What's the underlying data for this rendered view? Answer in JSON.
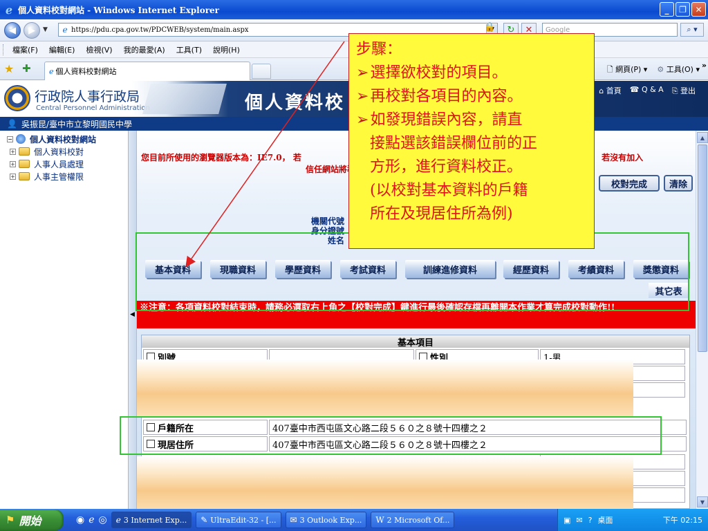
{
  "window": {
    "title": "個人資料校對網站 - Windows Internet Explorer",
    "buttons": {
      "minimize": "_",
      "restore": "❐",
      "close": "✕"
    }
  },
  "addressbar": {
    "url": "https://pdu.cpa.gov.tw/PDCWEB/system/main.aspx",
    "search_placeholder": "Google"
  },
  "menu": [
    "檔案(F)",
    "編輯(E)",
    "檢視(V)",
    "我的最愛(A)",
    "工具(T)",
    "說明(H)"
  ],
  "tabbar": {
    "tab_title": "個人資料校對網站",
    "tools": {
      "home": "網頁(P)",
      "tools": "工具(O)"
    }
  },
  "site": {
    "org_name": "行政院人事行政局",
    "org_name_en": "Central Personnel Administration",
    "banner_title": "個人資料校",
    "links": [
      "首頁",
      "Q & A",
      "登出"
    ],
    "user": "吳振昆/臺中市立黎明國民中學"
  },
  "sidebar": {
    "root": "個人資料校對網站",
    "items": [
      "個人資料校對",
      "人事人員處理",
      "人事主管權限"
    ]
  },
  "main": {
    "notice_line1": "您目前所使用的瀏覽器版本為：IE7.0， 若",
    "notice_line1_right": "任網站， 若沒有加入",
    "notice_line2": "信任網站將導致",
    "confirm_button": "校對完成",
    "clear_button": "清除",
    "id_labels": [
      "機關代號",
      "身分證號",
      "姓名"
    ],
    "tabs": [
      "基本資料",
      "現職資料",
      "學歷資料",
      "考試資料",
      "訓練進修資料",
      "經歷資料",
      "考績資料",
      "獎懲資料"
    ],
    "other_tab": "其它表",
    "warning": "※注意：各項資料校對結束時，請務必選取右上角之【校對完成】鍵進行最後確認存檔再離開本作業才算完成校對動作!!",
    "basic_title": "基本項目",
    "fields": {
      "alias_label": "別號",
      "gender_label": "性別",
      "gender_value": "1-男",
      "household_label": "戶籍所在",
      "household_value": "407臺中市西屯區文心路二段５６０之８號十四樓之２",
      "residence_label": "現居住所",
      "residence_value": "407臺中市西屯區文心路二段５６０之８號十四樓之２"
    }
  },
  "callout": {
    "heading": "步驟：",
    "steps": [
      "選擇欲校對的項目。",
      "再校對各項目的內容。",
      "如發現錯誤內容，請直"
    ],
    "continuation": [
      "接點選該錯誤欄位前的正",
      "方形，進行資料校正。",
      "(以校對基本資料的戶籍",
      "所在及現居住所為例)"
    ]
  },
  "taskbar": {
    "start": "開始",
    "items": [
      "3 Internet Exp...",
      "UltraEdit-32 - [...",
      "3 Outlook Exp...",
      "2 Microsoft Of..."
    ],
    "tray_label": "桌面",
    "clock": "下午 02:15"
  },
  "colors": {
    "title_blue": "#0a4ad0",
    "callout_bg": "#fffb3c",
    "callout_text": "#e0121b",
    "warning_red": "#e00000",
    "highlight_green": "#33c433"
  }
}
